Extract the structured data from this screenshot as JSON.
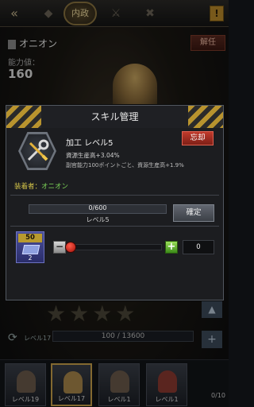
{
  "background": {
    "tab_active": "内政",
    "character_name": "オニオン",
    "release_label": "解任",
    "ability_label": "能力値：",
    "ability_value": "160",
    "level_label": "レベル17",
    "exp_text": "100 / 13600",
    "roster": [
      {
        "level": "レベル19",
        "active": false
      },
      {
        "level": "レベル17",
        "active": true
      },
      {
        "level": "レベル1",
        "active": false
      },
      {
        "level": "レベル1",
        "active": false
      }
    ],
    "roster_count": "0/10",
    "stars_filled": 0,
    "stars_total": 4
  },
  "modal": {
    "title": "スキル管理",
    "skill_icon": "wrench-screwdriver-icon",
    "skill_name": "加工 レベル5",
    "effect_line1": "資源生産高+3.04%",
    "effect_line2": "副官能力100ポイントごと、資源生産高+1.9%",
    "forget_label": "忘却",
    "equipped_label": "装着者：",
    "equipped_name": "オニオン",
    "progress_text": "0/600",
    "progress_fraction": 0,
    "level_text": "レベル5",
    "confirm_label": "確定",
    "item_count": "50",
    "item_owned": "2",
    "slider_fraction": 0,
    "minus_label": "−",
    "plus_label": "+",
    "quantity": "0"
  },
  "colors": {
    "accent_gold": "#b8932e",
    "forget_red": "#c03a2c",
    "equipped_yellow": "#d8c84a",
    "equipped_green": "#7ed858",
    "plus_green": "#3a8a18",
    "progress_blue": "#6c8fb8"
  }
}
